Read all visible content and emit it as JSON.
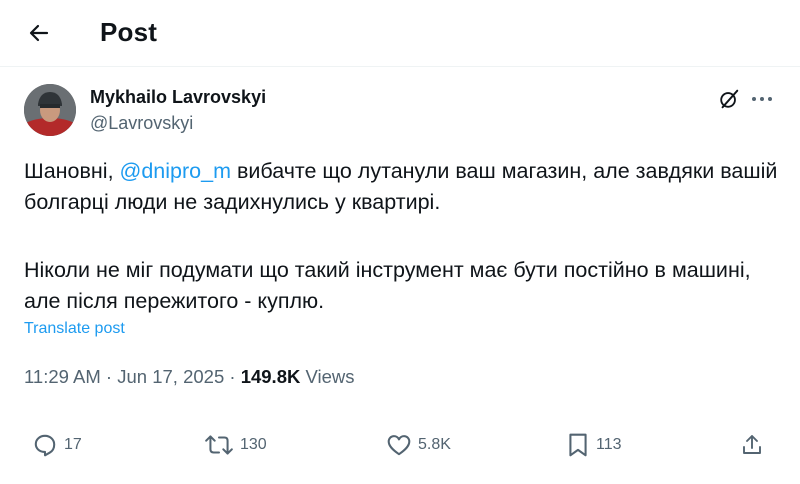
{
  "header": {
    "title": "Post"
  },
  "author": {
    "name": "Mykhailo Lavrovskyi",
    "handle": "@Lavrovskyi"
  },
  "post": {
    "p1_prefix": "Шановні, ",
    "mention": "@dnipro_m",
    "p1_suffix": " вибачте що лутанули ваш магазин, але завдяки вашій болгарці люди не задихнулись у квартирі.",
    "p2": "Ніколи не міг подумати що такий інструмент має бути постійно в машині, але після пережитого - куплю.",
    "translate_label": "Translate post",
    "time": "11:29 AM",
    "sep1": " · ",
    "date": "Jun 17, 2025",
    "sep2": " · ",
    "views_count": "149.8K",
    "views_label": " Views"
  },
  "actions": {
    "replies": "17",
    "reposts": "130",
    "likes": "5.8K",
    "bookmarks": "113"
  },
  "colors": {
    "accent": "#1d9bf0",
    "text": "#0f1419",
    "secondary": "#536471"
  },
  "icons": [
    "back-arrow-icon",
    "grok-icon",
    "more-icon",
    "reply-icon",
    "retweet-icon",
    "like-icon",
    "bookmark-icon",
    "share-icon"
  ]
}
